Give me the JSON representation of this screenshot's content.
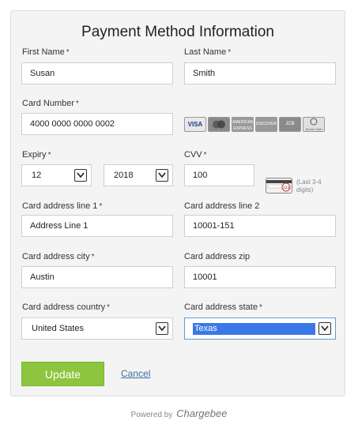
{
  "form": {
    "title": "Payment Method Information",
    "required_mark": "*"
  },
  "fields": {
    "first_name": {
      "label": "First Name",
      "value": "Susan"
    },
    "last_name": {
      "label": "Last Name",
      "value": "Smith"
    },
    "card_number": {
      "label": "Card Number",
      "value": "4000 0000 0000 0002"
    },
    "expiry": {
      "label": "Expiry",
      "month": "12",
      "year": "2018"
    },
    "cvv": {
      "label": "CVV",
      "value": "100",
      "hint": "(Last 3-4 digits)"
    },
    "address_line1": {
      "label": "Card address line 1",
      "value": "Address Line 1"
    },
    "address_line2": {
      "label": "Card address line 2",
      "value": "10001-151"
    },
    "city": {
      "label": "Card address city",
      "value": "Austin"
    },
    "zip": {
      "label": "Card address zip",
      "value": "10001"
    },
    "country": {
      "label": "Card address country",
      "value": "United States"
    },
    "state": {
      "label": "Card address state",
      "value": "Texas"
    }
  },
  "card_brands": [
    {
      "name": "VISA",
      "icon": "visa-icon",
      "color": "#1a3f8b"
    },
    {
      "name": "",
      "icon": "mastercard-icon",
      "color": "#8a8a8a"
    },
    {
      "name": "AMERICAN EXPRESS",
      "icon": "amex-icon",
      "color": "#9a9a9a"
    },
    {
      "name": "DISCOVER",
      "icon": "discover-icon",
      "color": "#9a9a9a"
    },
    {
      "name": "JCB",
      "icon": "jcb-icon",
      "color": "#8a8a8a"
    },
    {
      "name": "Diners Club",
      "icon": "diners-icon",
      "color": "#a0a0a0"
    }
  ],
  "actions": {
    "update_label": "Update",
    "cancel_label": "Cancel"
  },
  "footer": {
    "powered_by": "Powered by",
    "brand": "Chargebee"
  },
  "colors": {
    "accent_button": "#8dc53e",
    "link": "#3a6ea5",
    "selection": "#3b78e7"
  }
}
